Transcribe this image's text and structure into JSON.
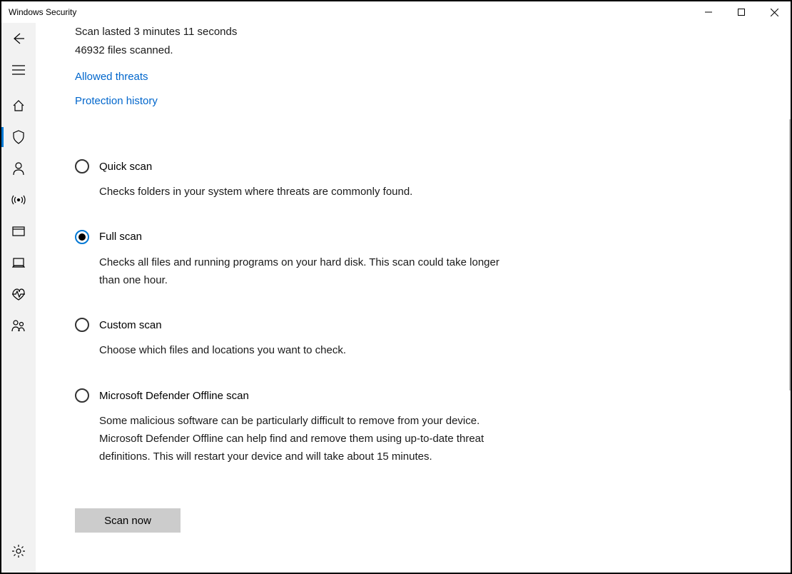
{
  "window": {
    "title": "Windows Security"
  },
  "scan": {
    "duration_line": "Scan lasted 3 minutes 11 seconds",
    "files_line": "46932 files scanned."
  },
  "links": {
    "allowed": "Allowed threats",
    "history": "Protection history"
  },
  "options": {
    "quick": {
      "title": "Quick scan",
      "desc": "Checks folders in your system where threats are commonly found."
    },
    "full": {
      "title": "Full scan",
      "desc": "Checks all files and running programs on your hard disk. This scan could take longer than one hour.",
      "selected": true
    },
    "custom": {
      "title": "Custom scan",
      "desc": "Choose which files and locations you want to check."
    },
    "offline": {
      "title": "Microsoft Defender Offline scan",
      "desc": "Some malicious software can be particularly difficult to remove from your device. Microsoft Defender Offline can help find and remove them using up-to-date threat definitions. This will restart your device and will take about 15 minutes."
    }
  },
  "buttons": {
    "scan_now": "Scan now"
  }
}
